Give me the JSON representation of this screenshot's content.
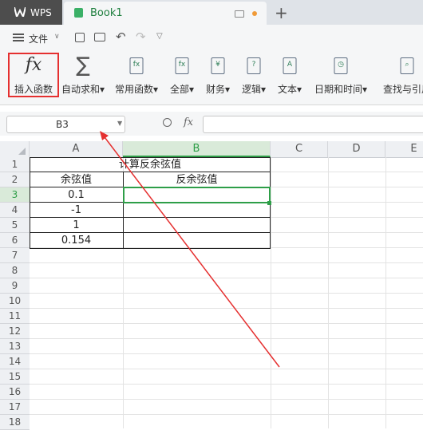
{
  "tabs": {
    "app": "WPS",
    "doc": "Book1"
  },
  "menu": {
    "file": "文件"
  },
  "ribbon": {
    "items": [
      {
        "label": "插入函数",
        "icon": "fx-icon"
      },
      {
        "label": "自动求和",
        "icon": "sum-icon"
      },
      {
        "label": "常用函数",
        "icon": "common-functions-icon"
      },
      {
        "label": "全部",
        "icon": "all-functions-icon"
      },
      {
        "label": "财务",
        "icon": "finance-icon"
      },
      {
        "label": "逻辑",
        "icon": "logic-icon"
      },
      {
        "label": "文本",
        "icon": "text-icon"
      },
      {
        "label": "日期和时间",
        "icon": "datetime-icon"
      },
      {
        "label": "查找与引用",
        "icon": "lookup-icon"
      }
    ]
  },
  "formula_bar": {
    "name_box": "B3",
    "fx": "fx",
    "formula": ""
  },
  "sheet": {
    "columns": [
      "A",
      "B",
      "C",
      "D",
      "E"
    ],
    "rows": [
      "1",
      "2",
      "3",
      "4",
      "5",
      "6",
      "7",
      "8",
      "9",
      "10",
      "11",
      "12",
      "13",
      "14",
      "15",
      "16",
      "17",
      "18"
    ],
    "title": "计算反余弦值",
    "headers": [
      "余弦值",
      "反余弦值"
    ],
    "values": [
      "0.1",
      "-1",
      "1",
      "0.154"
    ],
    "selected_cell": "B3"
  },
  "colors": {
    "accent_green": "#2e9e48",
    "highlight_red": "#e53030",
    "wps_dark": "#4d4d4d"
  }
}
